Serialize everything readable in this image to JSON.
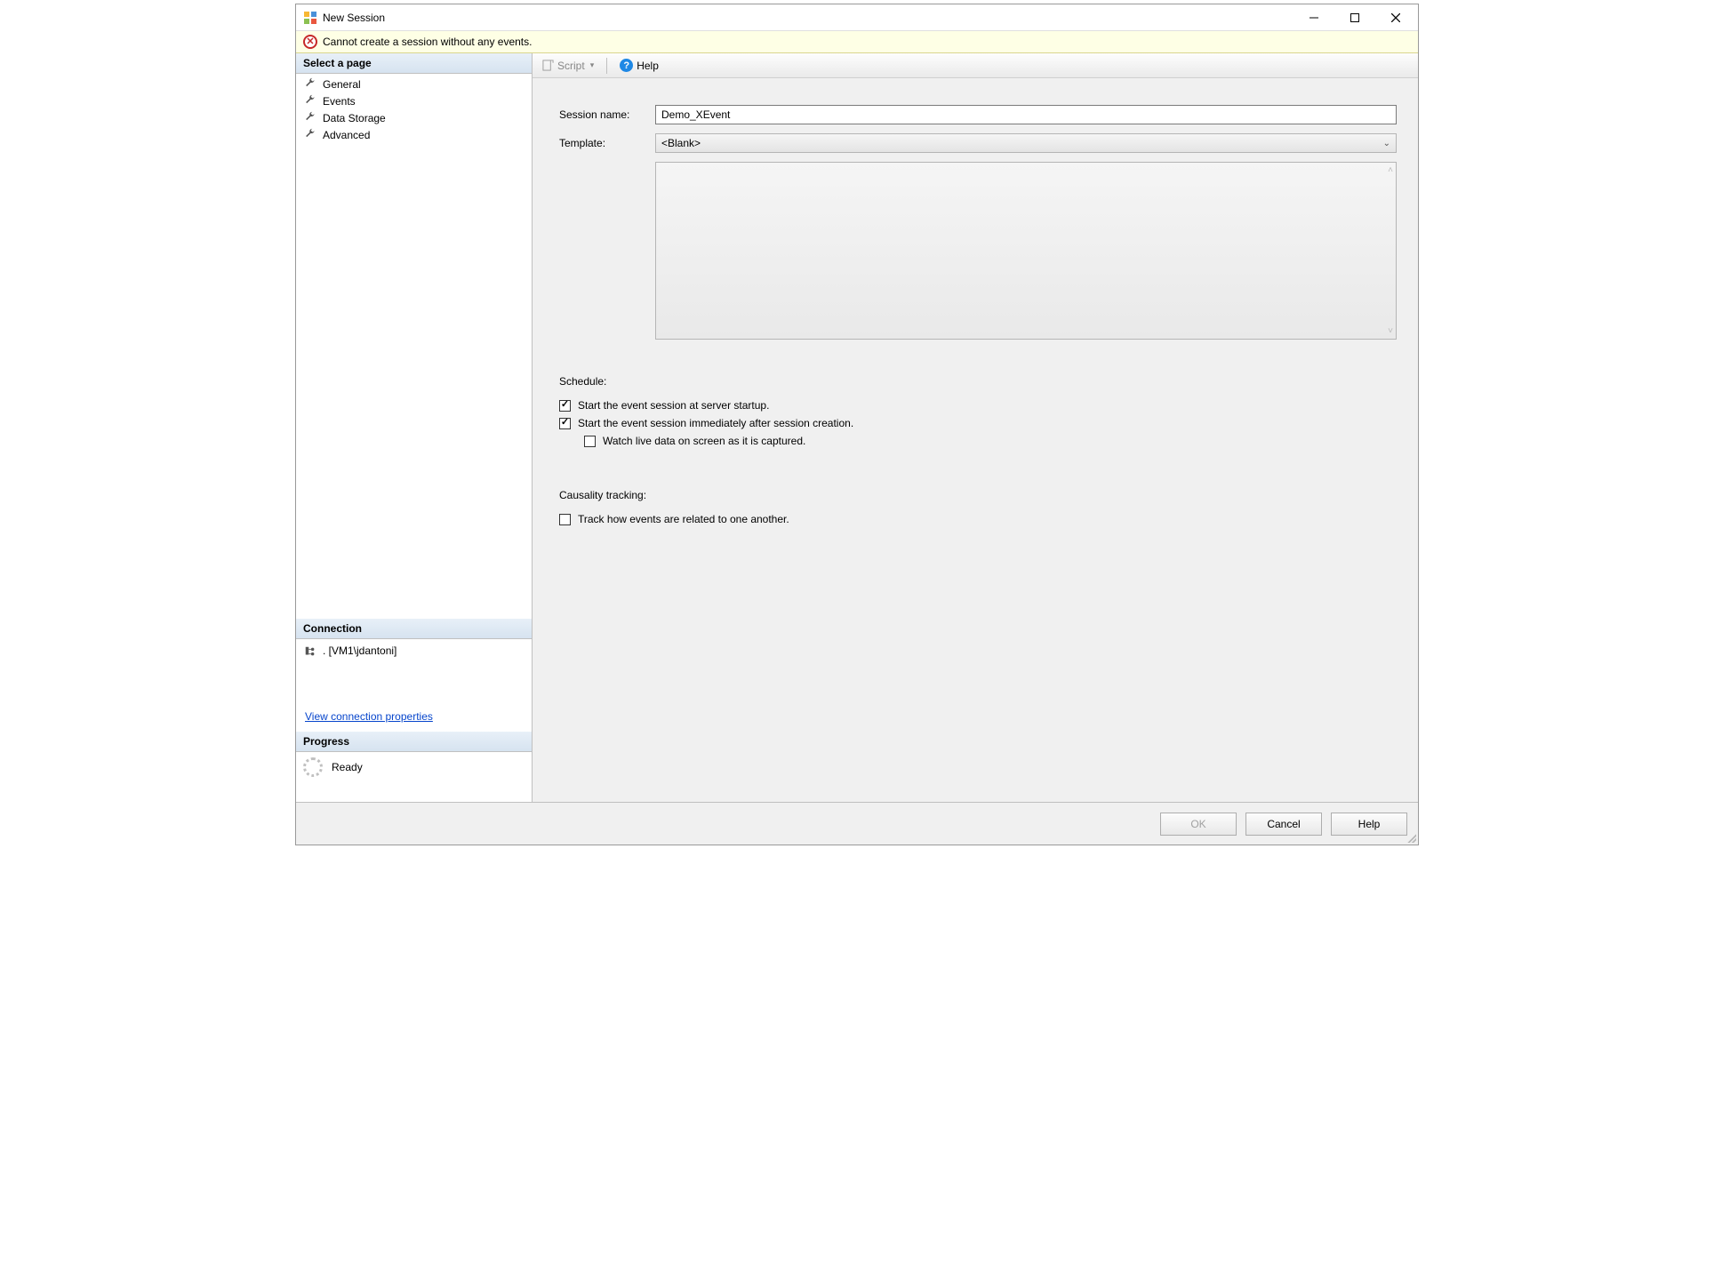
{
  "window": {
    "title": "New Session"
  },
  "error": {
    "message": "Cannot create a session without any events."
  },
  "sidebar": {
    "select_page_header": "Select a page",
    "pages": [
      {
        "label": "General"
      },
      {
        "label": "Events"
      },
      {
        "label": "Data Storage"
      },
      {
        "label": "Advanced"
      }
    ],
    "connection_header": "Connection",
    "connection_value": ". [VM1\\jdantoni]",
    "view_connection_link": "View connection properties",
    "progress_header": "Progress",
    "progress_status": "Ready"
  },
  "toolbar": {
    "script_label": "Script",
    "help_label": "Help"
  },
  "form": {
    "session_name_label": "Session name:",
    "session_name_value": "Demo_XEvent",
    "template_label": "Template:",
    "template_value": "<Blank>",
    "schedule_label": "Schedule:",
    "schedule_startup_label": "Start the event session at server startup.",
    "schedule_startup_checked": true,
    "schedule_immediate_label": "Start the event session immediately after session creation.",
    "schedule_immediate_checked": true,
    "schedule_watch_label": "Watch live data on screen as it is captured.",
    "schedule_watch_checked": false,
    "causality_label": "Causality tracking:",
    "causality_track_label": "Track how events are related to one another.",
    "causality_track_checked": false
  },
  "footer": {
    "ok_label": "OK",
    "cancel_label": "Cancel",
    "help_label": "Help"
  }
}
